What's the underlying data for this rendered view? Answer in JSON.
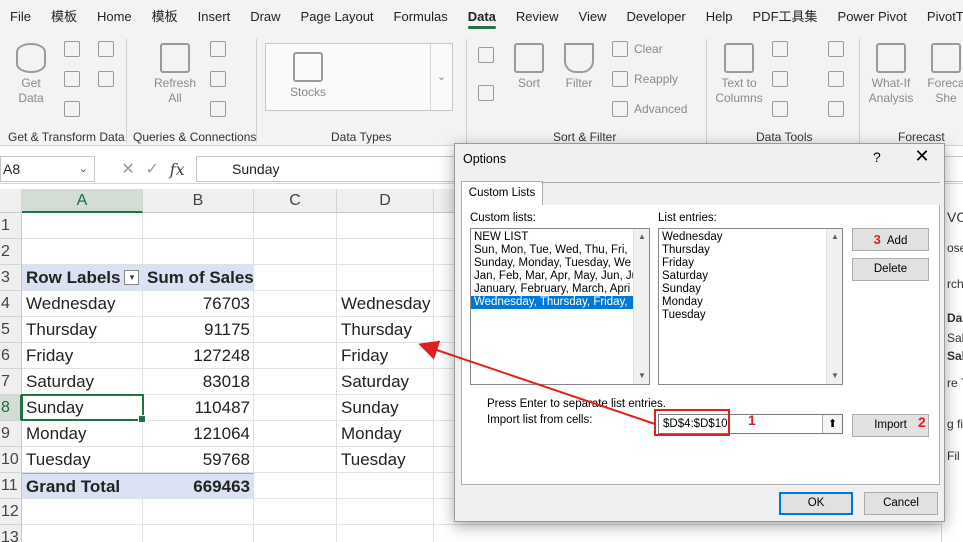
{
  "menu": {
    "tabs": [
      "File",
      "模板",
      "Home",
      "模板",
      "Insert",
      "Draw",
      "Page Layout",
      "Formulas",
      "Data",
      "Review",
      "View",
      "Developer",
      "Help",
      "PDF工具集",
      "Power Pivot",
      "PivotT"
    ],
    "active_tab": "Data"
  },
  "ribbon": {
    "get_data": "Get Data",
    "refresh_all": "Refresh All",
    "stocks": "Stocks",
    "sort": "Sort",
    "filter": "Filter",
    "clear": "Clear",
    "reapply": "Reapply",
    "advanced": "Advanced",
    "text_to_columns": "Text to Columns",
    "what_if": "What-If Analysis",
    "forecast": "Foreca She",
    "groups": {
      "get_transform": "Get & Transform Data",
      "queries": "Queries & Connections",
      "data_types": "Data Types",
      "sort_filter": "Sort & Filter",
      "data_tools": "Data Tools",
      "forecast": "Forecast"
    }
  },
  "formula_bar": {
    "name_box": "A8",
    "formula": "Sunday"
  },
  "sheet": {
    "columns": [
      "A",
      "B",
      "C",
      "D"
    ],
    "selected_column": "A",
    "rows": [
      "1",
      "2",
      "3",
      "4",
      "5",
      "6",
      "7",
      "8",
      "9",
      "10",
      "11",
      "12",
      "13"
    ],
    "selected_row": "8",
    "pivot_header": [
      "Row Labels",
      "Sum of Sales"
    ],
    "pivot_rows": [
      {
        "label": "Wednesday",
        "value": "76703"
      },
      {
        "label": "Thursday",
        "value": "91175"
      },
      {
        "label": "Friday",
        "value": "127248"
      },
      {
        "label": "Saturday",
        "value": "83018"
      },
      {
        "label": "Sunday",
        "value": "110487"
      },
      {
        "label": "Monday",
        "value": "121064"
      },
      {
        "label": "Tuesday",
        "value": "59768"
      }
    ],
    "grand_total": {
      "label": "Grand Total",
      "value": "669463"
    },
    "column_d": [
      "Wednesday",
      "Thursday",
      "Friday",
      "Saturday",
      "Sunday",
      "Monday",
      "Tuesday"
    ]
  },
  "task_pane_fragments": [
    "VO",
    "ose",
    "rch",
    "Day",
    "Sale",
    "Sale",
    "re T",
    "g fi",
    "Fil"
  ],
  "dialog": {
    "title": "Options",
    "help": "?",
    "close": "✕",
    "tab": "Custom Lists",
    "custom_lists_label": "Custom lists:",
    "list_entries_label": "List entries:",
    "custom_lists": [
      "NEW LIST",
      "Sun, Mon, Tue, Wed, Thu, Fri,",
      "Sunday, Monday, Tuesday, We",
      "Jan, Feb, Mar, Apr, May, Jun, Ju",
      "January, February, March, Apri",
      "Wednesday, Thursday, Friday,"
    ],
    "selected_list_index": 5,
    "list_entries": [
      "Wednesday",
      "Thursday",
      "Friday",
      "Saturday",
      "Sunday",
      "Monday",
      "Tuesday"
    ],
    "add_button": "Add",
    "delete_button": "Delete",
    "hint": "Press Enter to separate list entries.",
    "import_label": "Import list from cells:",
    "import_value": "$D$4:$D$10",
    "import_button": "Import",
    "ok_button": "OK",
    "cancel_button": "Cancel"
  },
  "annotations": {
    "step1": "1",
    "step2": "2",
    "step3": "3",
    "color": "#e02020"
  }
}
